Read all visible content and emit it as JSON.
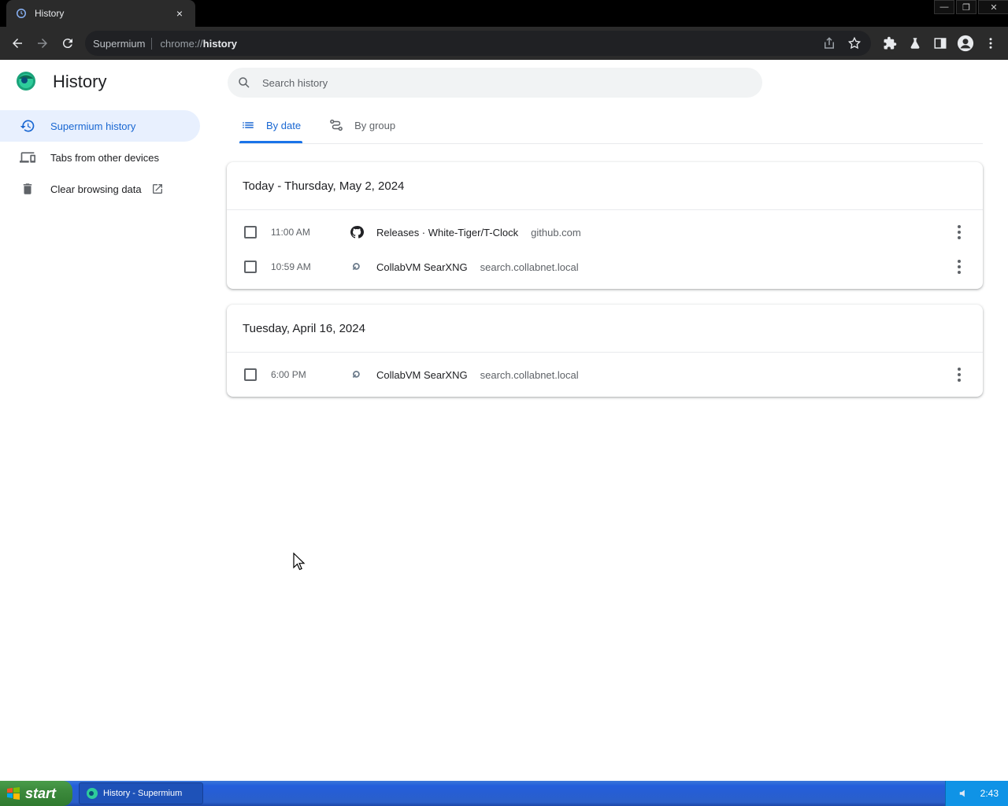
{
  "browser": {
    "tab_title": "History",
    "tab_close": "×",
    "window_controls": {
      "minimize": "—",
      "restore": "❐",
      "close": "✕"
    },
    "omnibox": {
      "site": "Supermium",
      "url_scheme": "chrome://",
      "url_path": "history"
    }
  },
  "page": {
    "title": "History",
    "search_placeholder": "Search history"
  },
  "sidebar": {
    "items": [
      {
        "label": "Supermium history",
        "icon": "history-icon"
      },
      {
        "label": "Tabs from other devices",
        "icon": "devices-icon"
      },
      {
        "label": "Clear browsing data",
        "icon": "trash-icon"
      }
    ]
  },
  "tabs": [
    {
      "label": "By date",
      "icon": "list-icon"
    },
    {
      "label": "By group",
      "icon": "journeys-icon"
    }
  ],
  "groups": [
    {
      "heading": "Today - Thursday, May 2, 2024",
      "entries": [
        {
          "time": "11:00 AM",
          "title": "Releases · White-Tiger/T-Clock",
          "domain": "github.com",
          "icon": "github-icon"
        },
        {
          "time": "10:59 AM",
          "title": "CollabVM SearXNG",
          "domain": "search.collabnet.local",
          "icon": "searxng-icon"
        }
      ]
    },
    {
      "heading": "Tuesday, April 16, 2024",
      "entries": [
        {
          "time": "6:00 PM",
          "title": "CollabVM SearXNG",
          "domain": "search.collabnet.local",
          "icon": "searxng-icon"
        }
      ]
    }
  ],
  "taskbar": {
    "start_label": "start",
    "task_label": "History - Supermium",
    "clock": "2:43"
  },
  "colors": {
    "accent": "#1a73e8",
    "active_bg": "#e8f0fe",
    "chrome_bg": "#2b2b2b"
  }
}
